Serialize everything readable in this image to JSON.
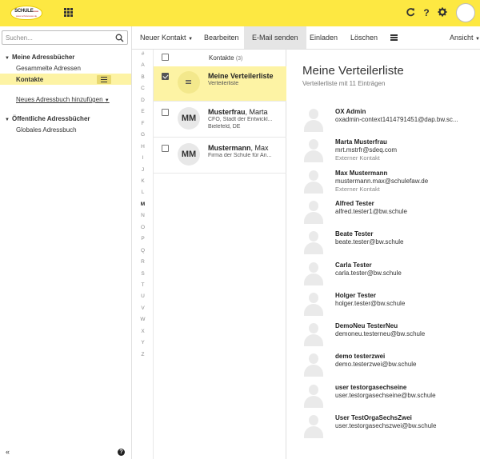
{
  "header": {
    "logo_text": "SCHULE",
    "logo_suffix": "www",
    "logo_sub": "www.schulewww.de",
    "icons": [
      "apps-icon",
      "refresh-icon",
      "help-icon",
      "settings-icon",
      "avatar"
    ]
  },
  "sidebar": {
    "search_placeholder": "Suchen...",
    "my_books_label": "Meine Adressbücher",
    "items": [
      {
        "label": "Gesammelte Adressen"
      },
      {
        "label": "Kontakte"
      }
    ],
    "add_book_label": "Neues Adressbuch hinzufügen",
    "public_books_label": "Öffentliche Adressbücher",
    "public_items": [
      {
        "label": "Globales Adressbuch"
      }
    ],
    "collapse_label": "«",
    "help_label": "?"
  },
  "toolbar": {
    "new_contact": "Neuer Kontakt",
    "edit": "Bearbeiten",
    "send_mail": "E-Mail senden",
    "invite": "Einladen",
    "delete": "Löschen",
    "view": "Ansicht"
  },
  "alphabet": [
    "#",
    "A",
    "B",
    "C",
    "D",
    "E",
    "F",
    "G",
    "H",
    "I",
    "J",
    "K",
    "L",
    "M",
    "N",
    "O",
    "P",
    "Q",
    "R",
    "S",
    "T",
    "U",
    "V",
    "W",
    "X",
    "Y",
    "Z"
  ],
  "alphabet_selected": "M",
  "list": {
    "header_label": "Kontakte",
    "header_count": "(3)",
    "rows": [
      {
        "initials": "",
        "title_bold": "Meine Verteilerliste",
        "title_rest": "",
        "line1": "Verteilerliste",
        "line2": "",
        "selected": true
      },
      {
        "initials": "MM",
        "title_bold": "Musterfrau",
        "title_rest": ", Marta",
        "line1": "CFO, Stadt der Entwickl...",
        "line2": "Bielefeld, DE",
        "selected": false
      },
      {
        "initials": "MM",
        "title_bold": "Mustermann",
        "title_rest": ", Max",
        "line1": "Firma der Schule für An...",
        "line2": "",
        "selected": false
      }
    ]
  },
  "detail": {
    "title": "Meine Verteilerliste",
    "subtitle": "Verteilerliste mit 11 Einträgen",
    "members": [
      {
        "name": "OX Admin",
        "email": "oxadmin-context1414791451@dap.bw.sc...",
        "note": ""
      },
      {
        "name": "Marta Musterfrau",
        "email": "mrt.mstrfr@sdeq.com",
        "note": "Externer Kontakt"
      },
      {
        "name": "Max Mustermann",
        "email": "mustermann.max@schulefaw.de",
        "note": "Externer Kontakt"
      },
      {
        "name": "Alfred Tester",
        "email": "alfred.tester1@bw.schule",
        "note": ""
      },
      {
        "name": "Beate Tester",
        "email": "beate.tester@bw.schule",
        "note": ""
      },
      {
        "name": "Carla Tester",
        "email": "carla.tester@bw.schule",
        "note": ""
      },
      {
        "name": "Holger Tester",
        "email": "holger.tester@bw.schule",
        "note": ""
      },
      {
        "name": "DemoNeu TesterNeu",
        "email": "demoneu.testerneu@bw.schule",
        "note": ""
      },
      {
        "name": "demo testerzwei",
        "email": "demo.testerzwei@bw.schule",
        "note": ""
      },
      {
        "name": "user testorgasechseine",
        "email": "user.testorgasechseine@bw.schule",
        "note": ""
      },
      {
        "name": "User TestOrgaSechsZwei",
        "email": "user.testorgasechszwei@bw.schule",
        "note": ""
      }
    ]
  },
  "colors": {
    "brand_yellow": "#fde842",
    "selection": "#fdf3a4",
    "active_tab": "#e5e5e5"
  }
}
